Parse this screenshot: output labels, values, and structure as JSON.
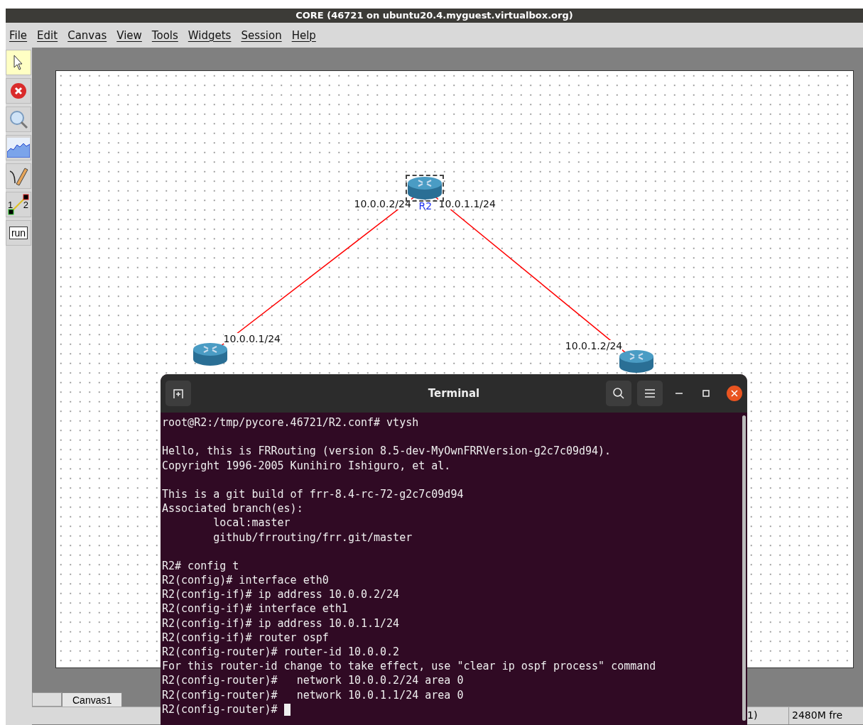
{
  "window": {
    "title": "CORE (46721 on ubuntu20.4.myguest.virtualbox.org)"
  },
  "menu": [
    "File",
    "Edit",
    "Canvas",
    "View",
    "Tools",
    "Widgets",
    "Session",
    "Help"
  ],
  "toolbar": [
    {
      "kind": "select",
      "selected": true
    },
    {
      "kind": "stop",
      "selected": false
    },
    {
      "kind": "zoom",
      "selected": false
    },
    {
      "kind": "chart",
      "selected": false
    },
    {
      "kind": "draw",
      "selected": false
    },
    {
      "kind": "link",
      "selected": false,
      "labels": [
        "1",
        "2"
      ]
    },
    {
      "kind": "run",
      "selected": false,
      "label": "run"
    }
  ],
  "canvas": {
    "nodes": [
      {
        "name": "R2",
        "selected": true
      },
      {
        "selected": false
      },
      {
        "selected": false
      }
    ],
    "links": [
      {
        "from_label": "10.0.0.2/24",
        "to_label": "10.0.0.1/24"
      },
      {
        "from_label": "10.0.1.1/24",
        "to_label": "10.0.1.2/24"
      }
    ]
  },
  "tabs": [
    {
      "label": "Canvas1",
      "selected": true
    }
  ],
  "status_bar": [
    "1)",
    "2480M fre"
  ],
  "terminal": {
    "title": "Terminal",
    "blocks": [
      [
        "root@R2:/tmp/pycore.46721/R2.conf# vtysh"
      ],
      [
        "Hello, this is FRRouting (version 8.5-dev-MyOwnFRRVersion-g2c7c09d94).",
        "Copyright 1996-2005 Kunihiro Ishiguro, et al."
      ],
      [
        "This is a git build of frr-8.4-rc-72-g2c7c09d94",
        "Associated branch(es):",
        "        local:master",
        "        github/frrouting/frr.git/master"
      ],
      [
        "R2# config t",
        "R2(config)# interface eth0",
        "R2(config-if)# ip address 10.0.0.2/24",
        "R2(config-if)# interface eth1",
        "R2(config-if)# ip address 10.0.1.1/24",
        "R2(config-if)# router ospf",
        "R2(config-router)# router-id 10.0.0.2",
        "For this router-id change to take effect, use \"clear ip ospf process\" command",
        "R2(config-router)#   network 10.0.0.2/24 area 0",
        "R2(config-router)#   network 10.0.1.1/24 area 0",
        "R2(config-router)# "
      ]
    ]
  }
}
